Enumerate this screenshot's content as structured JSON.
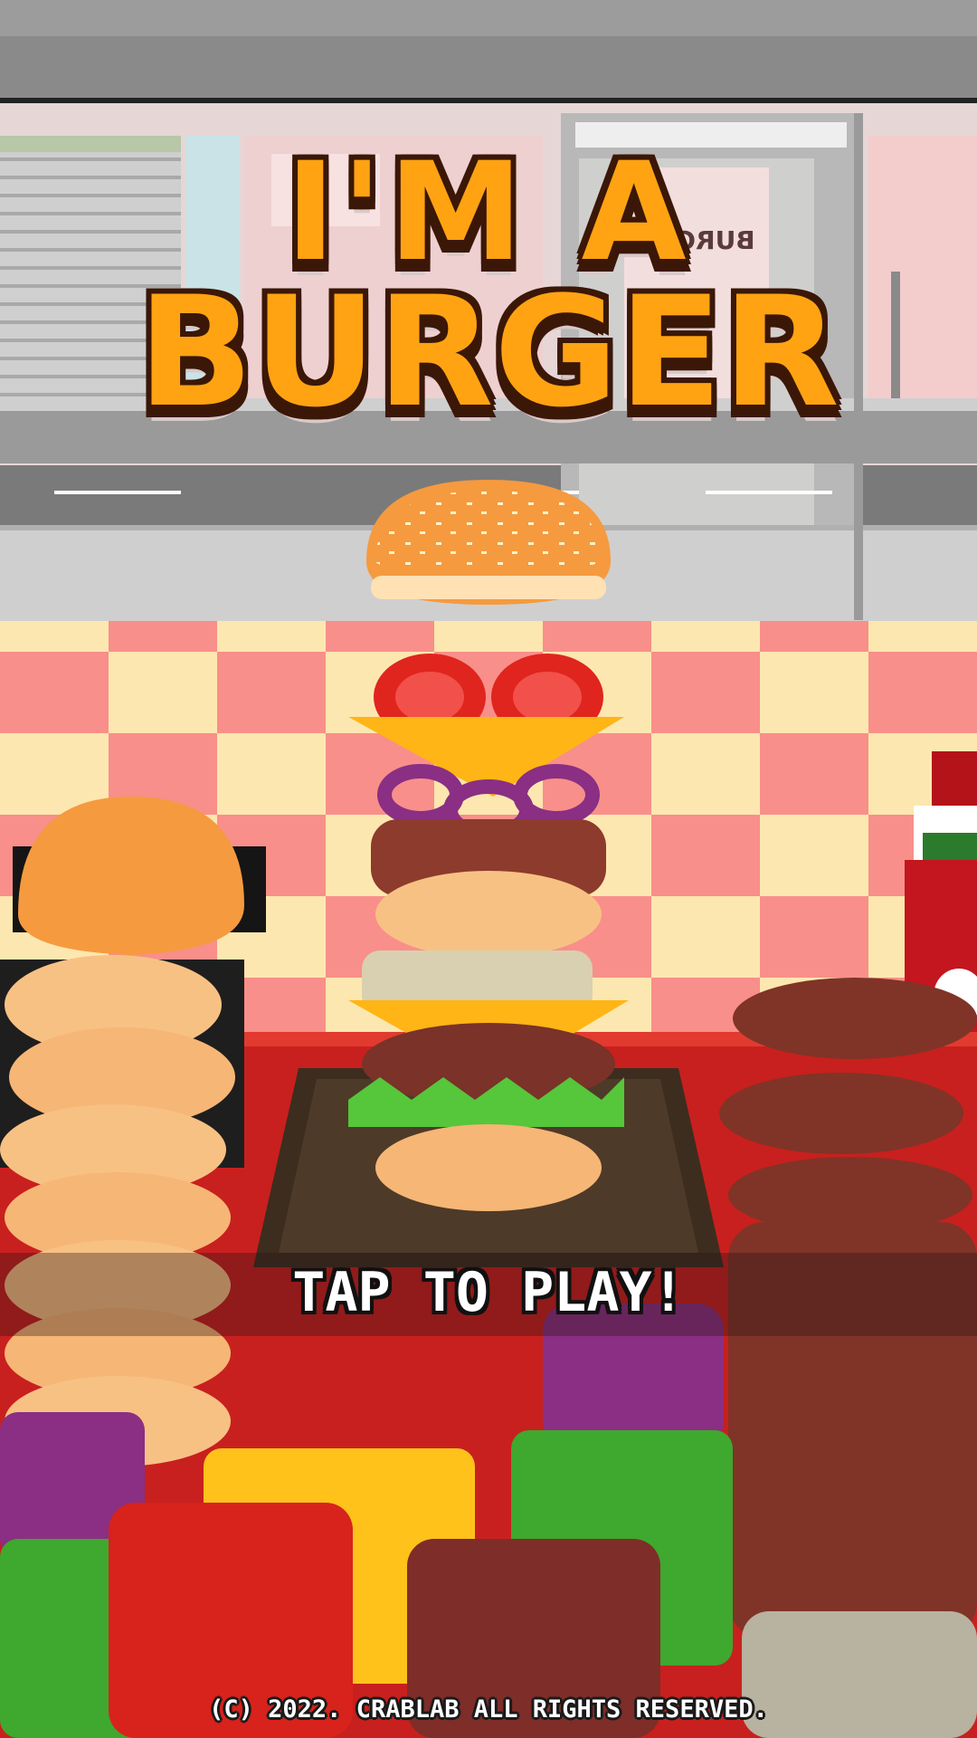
{
  "game": {
    "title_line1": "I'M A",
    "title_line2": "BURGER",
    "tap_prompt": "TAP TO PLAY!",
    "copyright": "(C) 2022. CRABLAB ALL RIGHTS RESERVED.",
    "shop_sign": "BURGER"
  },
  "colors": {
    "title_fill": "#ffa312",
    "title_outline": "#3b1707",
    "checker_pink": "#f98f8a",
    "checker_cream": "#fde7b0",
    "counter_red": "#c8201e"
  }
}
